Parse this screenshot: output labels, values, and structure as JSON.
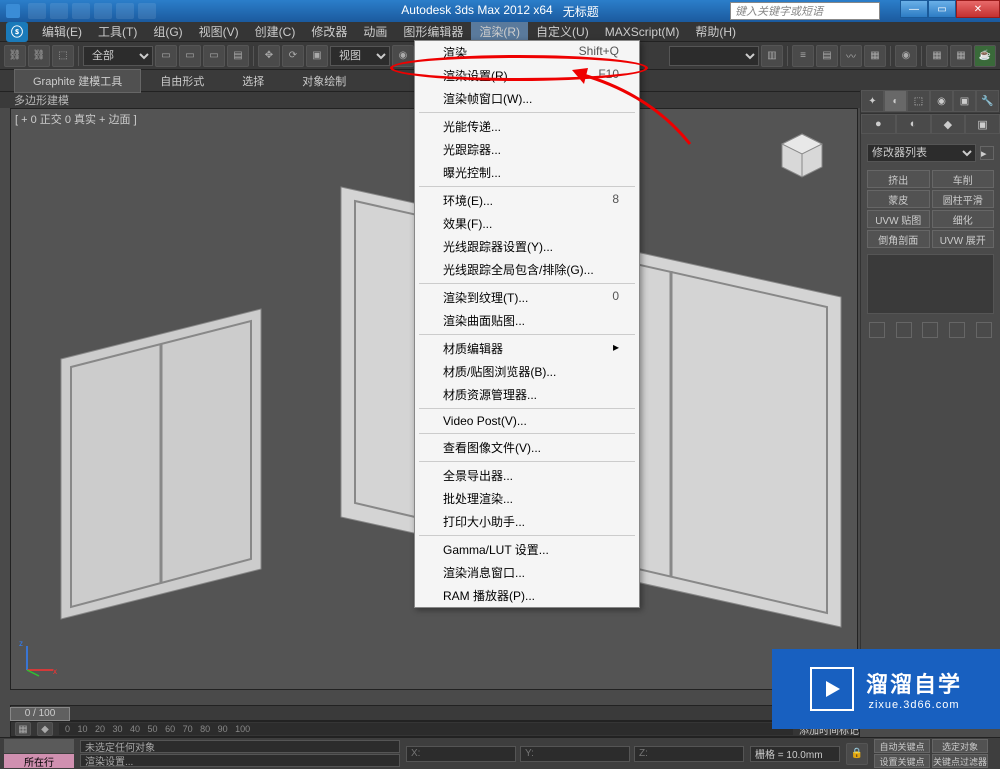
{
  "title": {
    "app": "Autodesk 3ds Max  2012  x64",
    "doc": "无标题"
  },
  "search_placeholder": "键入关键字或短语",
  "menus": [
    "编辑(E)",
    "工具(T)",
    "组(G)",
    "视图(V)",
    "创建(C)",
    "修改器",
    "动画",
    "图形编辑器",
    "渲染(R)",
    "自定义(U)",
    "MAXScript(M)",
    "帮助(H)"
  ],
  "active_menu_index": 8,
  "toolbar_selects": {
    "all": "全部",
    "view": "视图"
  },
  "ribbon_tabs": [
    "Graphite 建模工具",
    "自由形式",
    "选择",
    "对象绘制"
  ],
  "ribbon_sub": "多边形建模",
  "viewport_label": "[ + 0 正交 0 真实 + 边面 ]",
  "dropdown": [
    {
      "label": "渲染",
      "shortcut": "Shift+Q"
    },
    {
      "label": "渲染设置(R)...",
      "shortcut": "F10",
      "highlighted": true
    },
    {
      "label": "渲染帧窗口(W)..."
    },
    {
      "sep": true
    },
    {
      "label": "光能传递..."
    },
    {
      "label": "光跟踪器..."
    },
    {
      "label": "曝光控制..."
    },
    {
      "sep": true
    },
    {
      "label": "环境(E)...",
      "shortcut": "8"
    },
    {
      "label": "效果(F)..."
    },
    {
      "label": "光线跟踪器设置(Y)..."
    },
    {
      "label": "光线跟踪全局包含/排除(G)..."
    },
    {
      "sep": true
    },
    {
      "label": "渲染到纹理(T)...",
      "shortcut": "0"
    },
    {
      "label": "渲染曲面贴图..."
    },
    {
      "sep": true
    },
    {
      "label": "材质编辑器",
      "submenu": true
    },
    {
      "label": "材质/贴图浏览器(B)..."
    },
    {
      "label": "材质资源管理器..."
    },
    {
      "sep": true
    },
    {
      "label": "Video Post(V)..."
    },
    {
      "sep": true
    },
    {
      "label": "查看图像文件(V)..."
    },
    {
      "sep": true
    },
    {
      "label": "全景导出器..."
    },
    {
      "label": "批处理渲染..."
    },
    {
      "label": "打印大小助手..."
    },
    {
      "sep": true
    },
    {
      "label": "Gamma/LUT 设置..."
    },
    {
      "label": "渲染消息窗口..."
    },
    {
      "label": "RAM 播放器(P)..."
    }
  ],
  "modifier_dropdown": "修改器列表",
  "modifier_buttons": [
    "挤出",
    "车削",
    "蒙皮",
    "圆柱平滑",
    "UVW 贴图",
    "细化",
    "倒角剖面",
    "UVW 展开"
  ],
  "timeline": "0 / 100",
  "track_label": "添加时间标记",
  "status": {
    "pink_label": "所在行",
    "prompt1": "未选定任何对象",
    "prompt2": "渲染设置...",
    "x": "X:",
    "y": "Y:",
    "z": "Z:",
    "grid": "栅格 = 10.0mm",
    "autokey": "自动关键点",
    "selset": "选定对象",
    "setkey": "设置关键点",
    "keyfilter": "关键点过滤器"
  },
  "watermark": {
    "cn": "溜溜自学",
    "en": "zixue.3d66.com"
  }
}
